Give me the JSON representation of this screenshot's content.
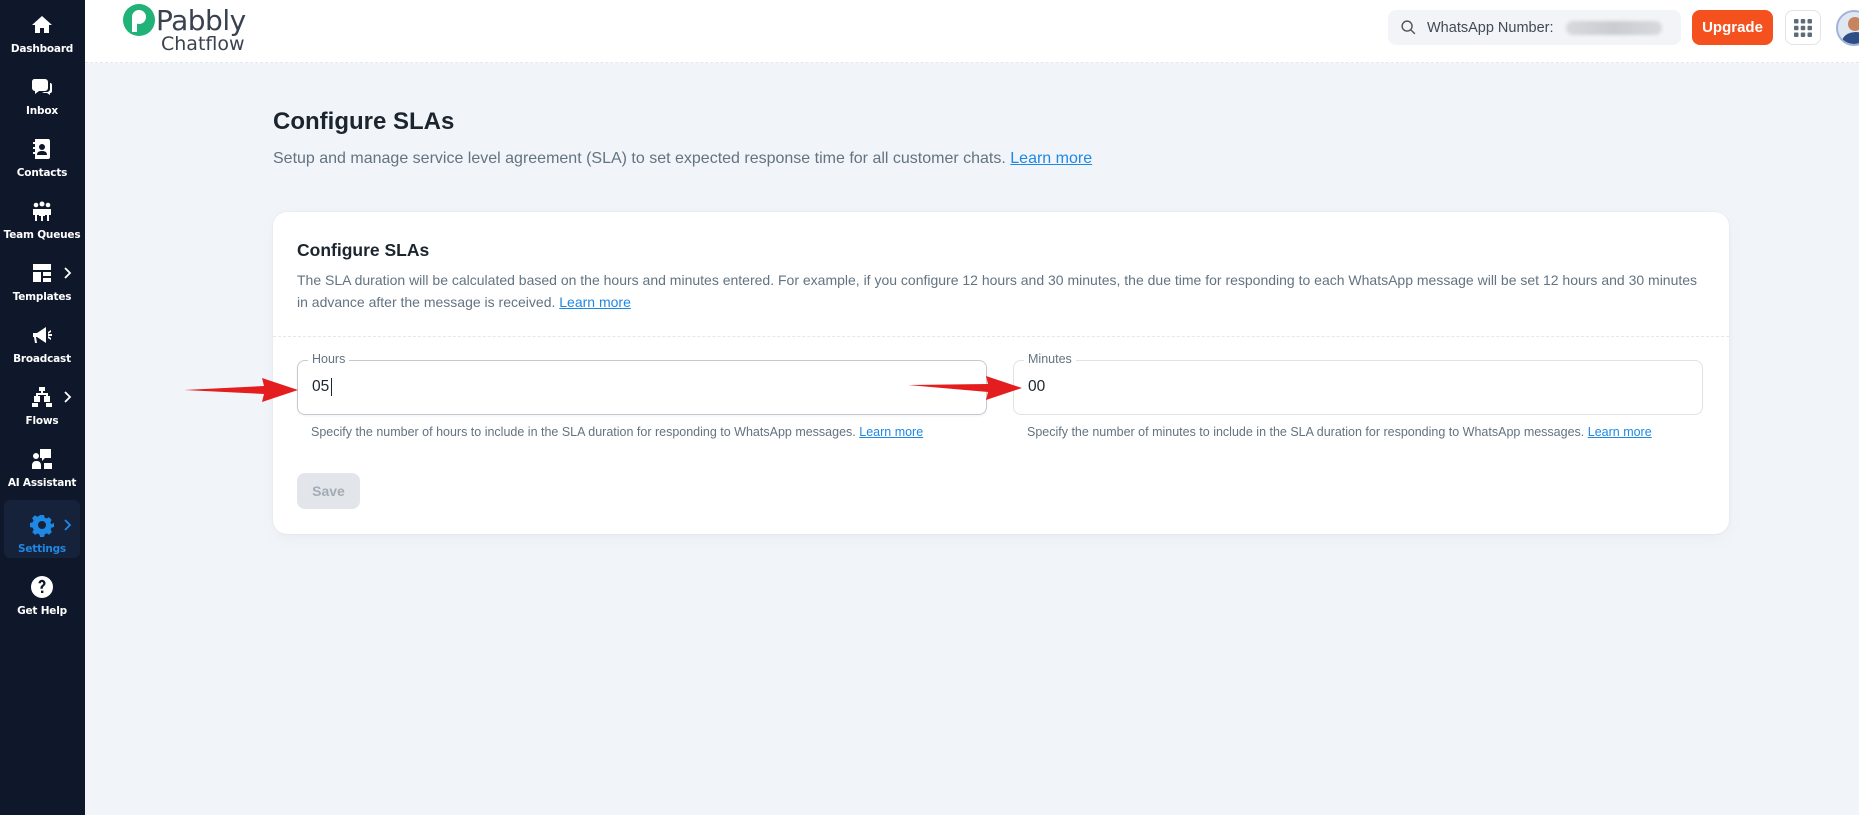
{
  "sidebar": {
    "items": [
      {
        "label": "Dashboard",
        "icon": "home-icon"
      },
      {
        "label": "Inbox",
        "icon": "chat-icon"
      },
      {
        "label": "Contacts",
        "icon": "contact-book-icon"
      },
      {
        "label": "Team Queues",
        "icon": "team-icon"
      },
      {
        "label": "Templates",
        "icon": "template-icon"
      },
      {
        "label": "Broadcast",
        "icon": "megaphone-icon"
      },
      {
        "label": "Flows",
        "icon": "flow-icon"
      },
      {
        "label": "AI Assistant",
        "icon": "ai-assistant-icon"
      },
      {
        "label": "Settings",
        "icon": "gear-icon"
      },
      {
        "label": "Get Help",
        "icon": "help-icon"
      }
    ],
    "active": "Settings",
    "accent_color": "#1e88e5"
  },
  "header": {
    "logo_word": "Pabbly",
    "logo_sub": "Chatflow",
    "search_label": "WhatsApp Number:",
    "upgrade_label": "Upgrade",
    "upgrade_color": "#f4511e"
  },
  "page": {
    "title": "Configure SLAs",
    "description": "Setup and manage service level agreement (SLA) to set expected response time for all customer chats.",
    "learn_more": "Learn more"
  },
  "card": {
    "title": "Configure SLAs",
    "description": "The SLA duration will be calculated based on the hours and minutes entered. For example, if you configure 12 hours and 30 minutes, the due time for responding to each WhatsApp message will be set 12 hours and 30 minutes in advance after the message is received.",
    "learn_more": "Learn more",
    "hours": {
      "label": "Hours",
      "value": "05",
      "helper": "Specify the number of hours to include in the SLA duration for responding to WhatsApp messages.",
      "learn_more": "Learn more"
    },
    "minutes": {
      "label": "Minutes",
      "value": "00",
      "helper": "Specify the number of minutes to include in the SLA duration for responding to WhatsApp messages.",
      "learn_more": "Learn more"
    },
    "save_label": "Save"
  }
}
